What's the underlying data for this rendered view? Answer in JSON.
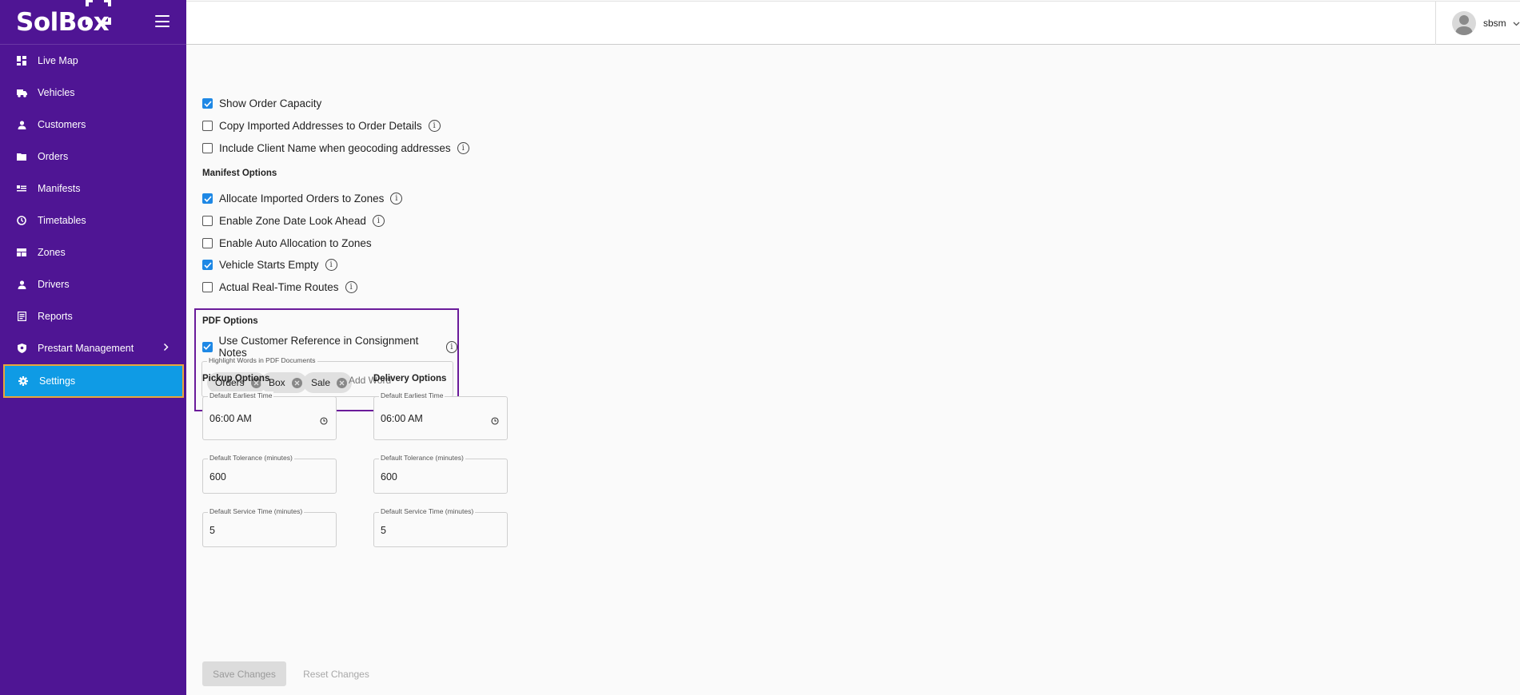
{
  "brand": {
    "name": "SolBox"
  },
  "sidebar": {
    "items": [
      {
        "label": "Live Map",
        "icon": "dashboard-icon"
      },
      {
        "label": "Vehicles",
        "icon": "truck-icon"
      },
      {
        "label": "Customers",
        "icon": "person-icon"
      },
      {
        "label": "Orders",
        "icon": "folder-icon"
      },
      {
        "label": "Manifests",
        "icon": "list-icon"
      },
      {
        "label": "Timetables",
        "icon": "clock-icon"
      },
      {
        "label": "Zones",
        "icon": "grid-icon"
      },
      {
        "label": "Drivers",
        "icon": "person-icon"
      },
      {
        "label": "Reports",
        "icon": "report-icon"
      },
      {
        "label": "Prestart Management",
        "icon": "shield-icon"
      },
      {
        "label": "Settings",
        "icon": "gear-icon"
      }
    ],
    "active_color": "#0f9be5",
    "background": "#4f1594"
  },
  "header": {
    "username": "sbsm"
  },
  "order_options": [
    {
      "label": "Show Order Capacity",
      "checked": true,
      "info": false
    },
    {
      "label": "Copy Imported Addresses to Order Details",
      "checked": false,
      "info": true
    },
    {
      "label": "Include Client Name when geocoding addresses",
      "checked": false,
      "info": true
    }
  ],
  "manifest": {
    "title": "Manifest Options",
    "options": [
      {
        "label": "Allocate Imported Orders to Zones",
        "checked": true,
        "info": true
      },
      {
        "label": "Enable Zone Date Look Ahead",
        "checked": false,
        "info": true
      },
      {
        "label": "Enable Auto Allocation to Zones",
        "checked": false,
        "info": false
      },
      {
        "label": "Vehicle Starts Empty",
        "checked": true,
        "info": true
      },
      {
        "label": "Actual Real-Time Routes",
        "checked": false,
        "info": true
      }
    ]
  },
  "pdf": {
    "title": "PDF Options",
    "use_customer_ref": {
      "label": "Use Customer Reference in Consignment Notes",
      "checked": true
    },
    "highlight_label": "Highlight Words in PDF Documents",
    "words": [
      "Orders",
      "Box",
      "Sale"
    ],
    "add_placeholder": "Add Word"
  },
  "pickup": {
    "title": "Pickup Options",
    "earliest_label": "Default Earliest Time",
    "earliest_value": "06:00 AM",
    "tolerance_label": "Default Tolerance (minutes)",
    "tolerance_value": "600",
    "service_label": "Default Service Time (minutes)",
    "service_value": "5"
  },
  "delivery": {
    "title": "Delivery Options",
    "earliest_label": "Default Earliest Time",
    "earliest_value": "06:00 AM",
    "tolerance_label": "Default Tolerance (minutes)",
    "tolerance_value": "600",
    "service_label": "Default Service Time (minutes)",
    "service_value": "5"
  },
  "actions": {
    "save": "Save Changes",
    "reset": "Reset Changes"
  }
}
